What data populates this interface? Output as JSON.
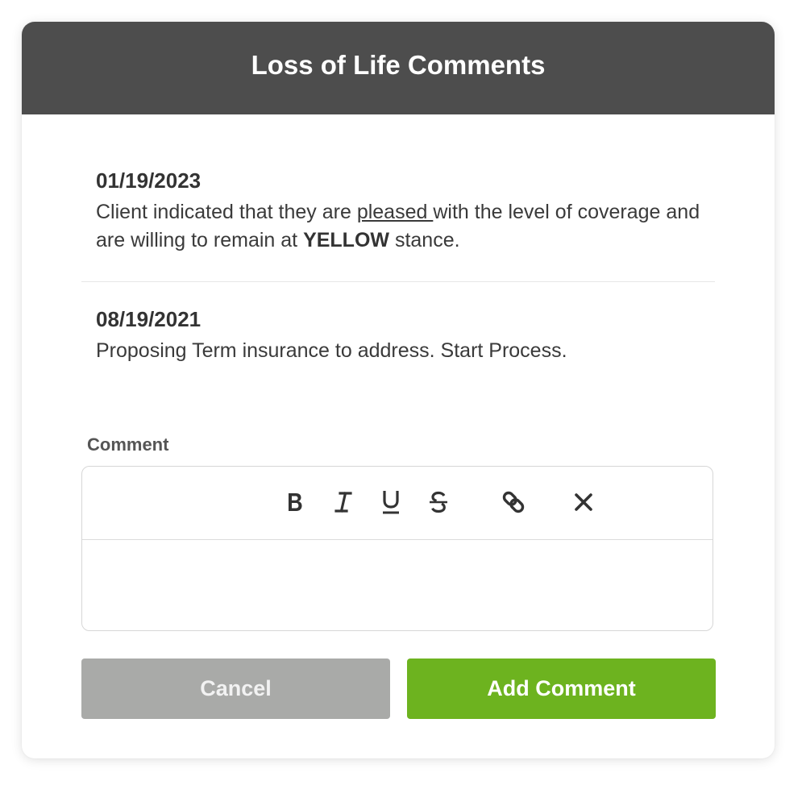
{
  "modal": {
    "title": "Loss of Life Comments"
  },
  "comments": [
    {
      "date": "01/19/2023",
      "text_before": "Client indicated that they are ",
      "text_underlined": "pleased ",
      "text_middle": "with the level of coverage and are willing to remain at ",
      "text_bold": "YELLOW",
      "text_after": " stance."
    },
    {
      "date": "08/19/2021",
      "text": "Proposing Term insurance to address. Start Process."
    }
  ],
  "editor": {
    "label": "Comment",
    "toolbar": [
      "bold-icon",
      "italic-icon",
      "underline-icon",
      "strikethrough-icon",
      "link-icon",
      "clear-format-icon"
    ],
    "value": ""
  },
  "actions": {
    "cancel_label": "Cancel",
    "add_label": "Add Comment"
  },
  "colors": {
    "header_bg": "#4d4d4d",
    "cancel_bg": "#a9aaa8",
    "add_bg": "#6db31f"
  }
}
